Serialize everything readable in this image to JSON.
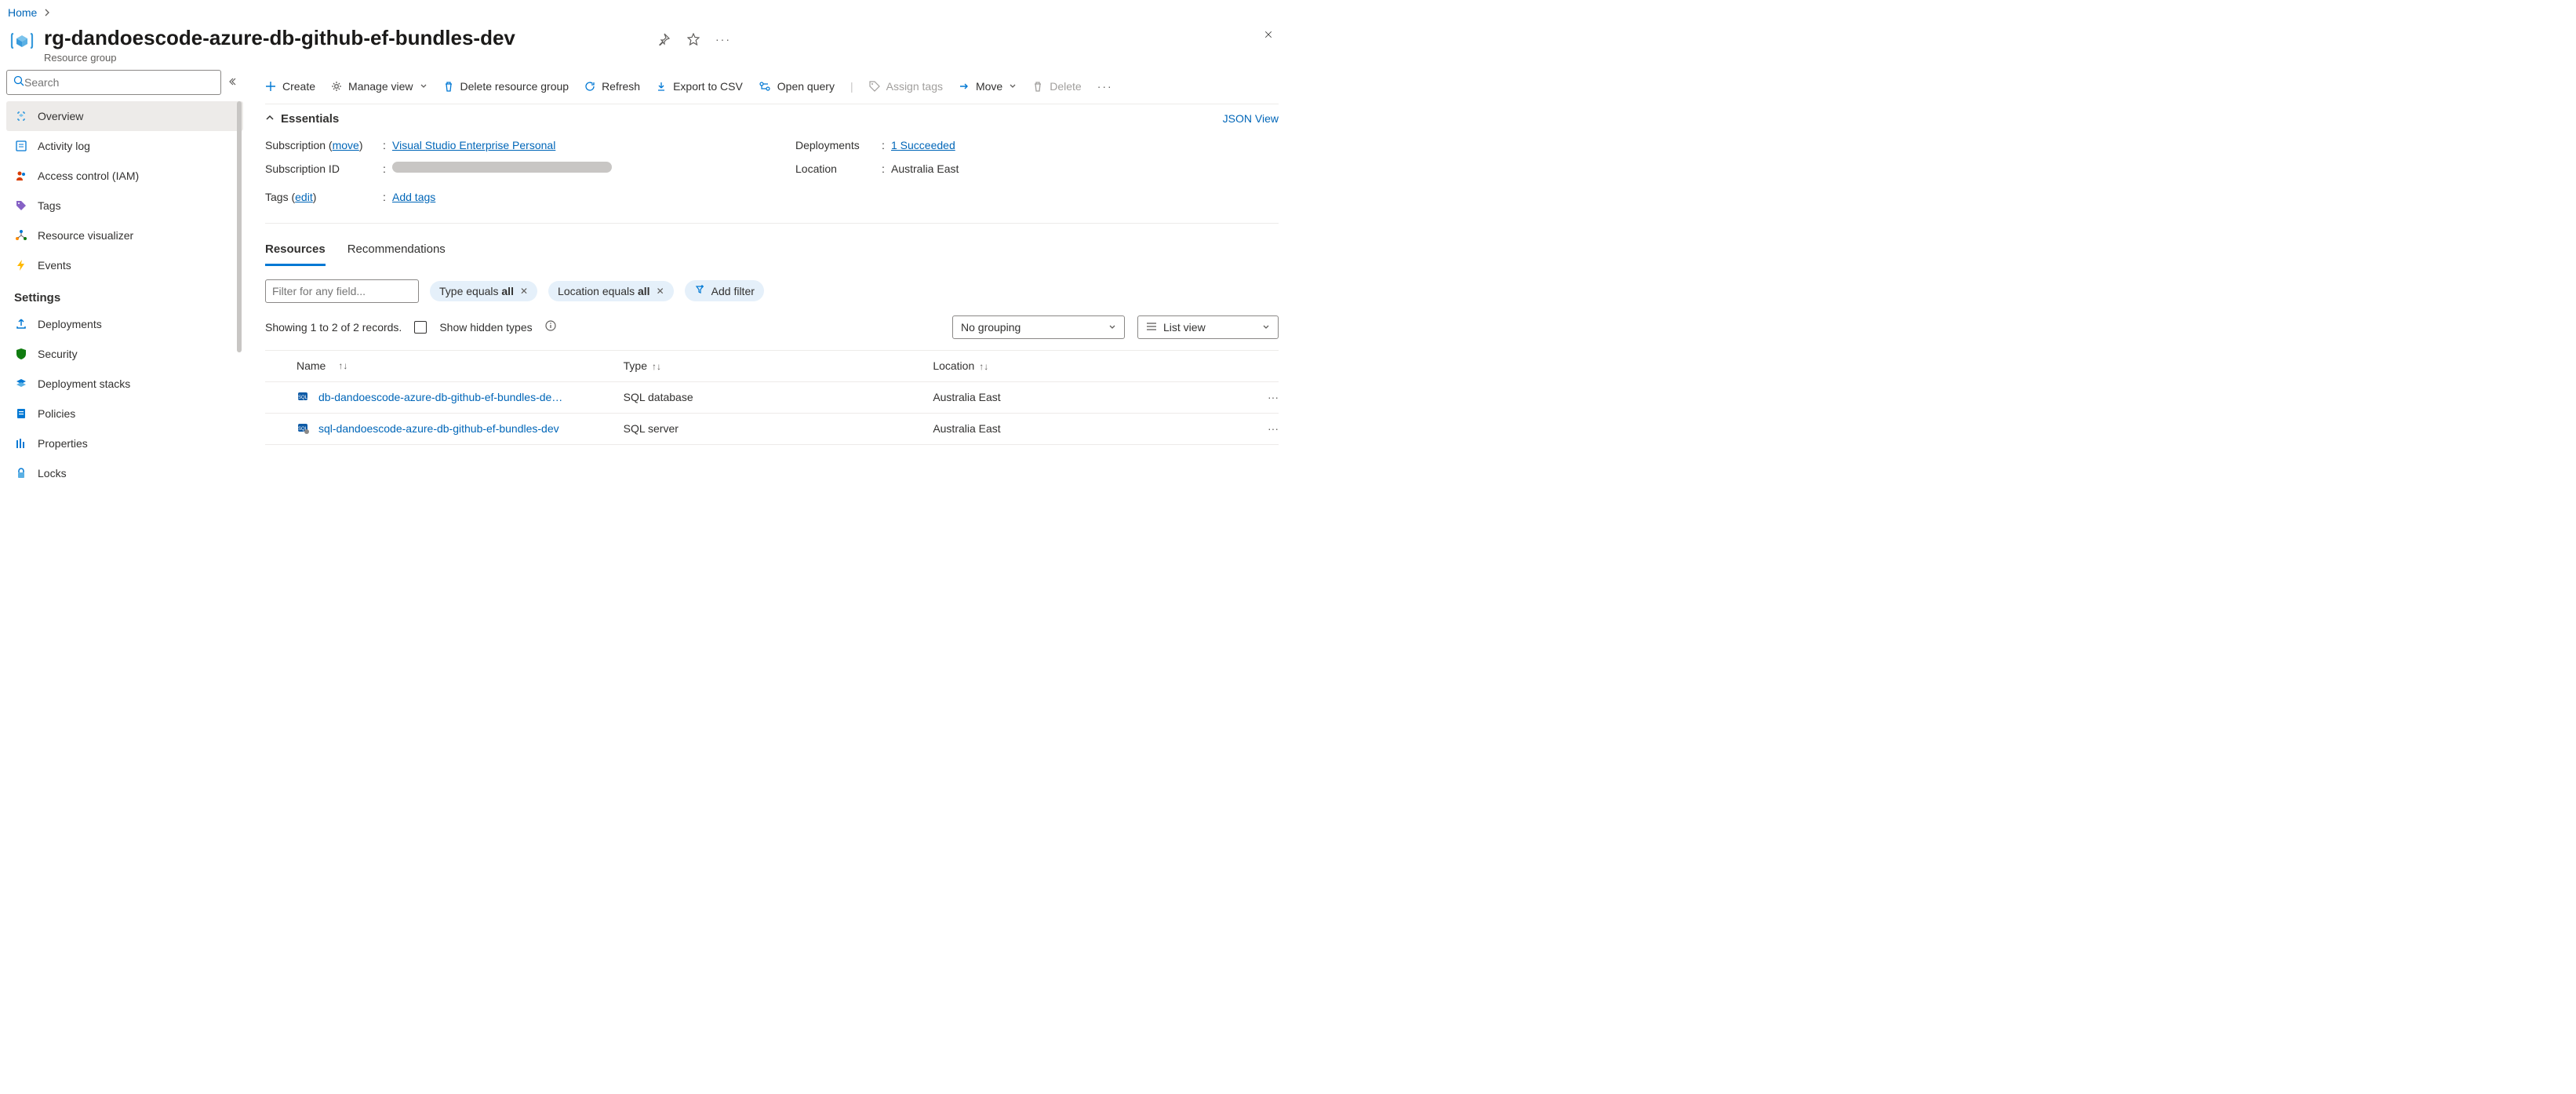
{
  "breadcrumb": {
    "home": "Home"
  },
  "header": {
    "title": "rg-dandoescode-azure-db-github-ef-bundles-dev",
    "subtitle": "Resource group"
  },
  "sidebar": {
    "search_placeholder": "Search",
    "items": [
      {
        "label": "Overview"
      },
      {
        "label": "Activity log"
      },
      {
        "label": "Access control (IAM)"
      },
      {
        "label": "Tags"
      },
      {
        "label": "Resource visualizer"
      },
      {
        "label": "Events"
      }
    ],
    "settings_title": "Settings",
    "settings_items": [
      {
        "label": "Deployments"
      },
      {
        "label": "Security"
      },
      {
        "label": "Deployment stacks"
      },
      {
        "label": "Policies"
      },
      {
        "label": "Properties"
      },
      {
        "label": "Locks"
      }
    ]
  },
  "toolbar": {
    "create": "Create",
    "manage_view": "Manage view",
    "delete_rg": "Delete resource group",
    "refresh": "Refresh",
    "export_csv": "Export to CSV",
    "open_query": "Open query",
    "assign_tags": "Assign tags",
    "move": "Move",
    "delete": "Delete"
  },
  "essentials": {
    "title": "Essentials",
    "json_view": "JSON View",
    "subscription_label": "Subscription",
    "subscription_move": "move",
    "subscription_value": "Visual Studio Enterprise Personal",
    "subscription_id_label": "Subscription ID",
    "tags_label": "Tags",
    "tags_edit": "edit",
    "add_tags": "Add tags",
    "deployments_label": "Deployments",
    "deployments_value": "1 Succeeded",
    "location_label": "Location",
    "location_value": "Australia East"
  },
  "tabs": {
    "resources": "Resources",
    "recommendations": "Recommendations"
  },
  "filters": {
    "placeholder": "Filter for any field...",
    "type_prefix": "Type equals ",
    "type_value": "all",
    "loc_prefix": "Location equals ",
    "loc_value": "all",
    "add": "Add filter"
  },
  "records": {
    "summary": "Showing 1 to 2 of 2 records.",
    "show_hidden": "Show hidden types",
    "grouping": "No grouping",
    "view_mode": "List view"
  },
  "table": {
    "col_name": "Name",
    "col_type": "Type",
    "col_location": "Location",
    "rows": [
      {
        "name": "db-dandoescode-azure-db-github-ef-bundles-de…",
        "type": "SQL database",
        "location": "Australia East"
      },
      {
        "name": "sql-dandoescode-azure-db-github-ef-bundles-dev",
        "type": "SQL server",
        "location": "Australia East"
      }
    ]
  }
}
